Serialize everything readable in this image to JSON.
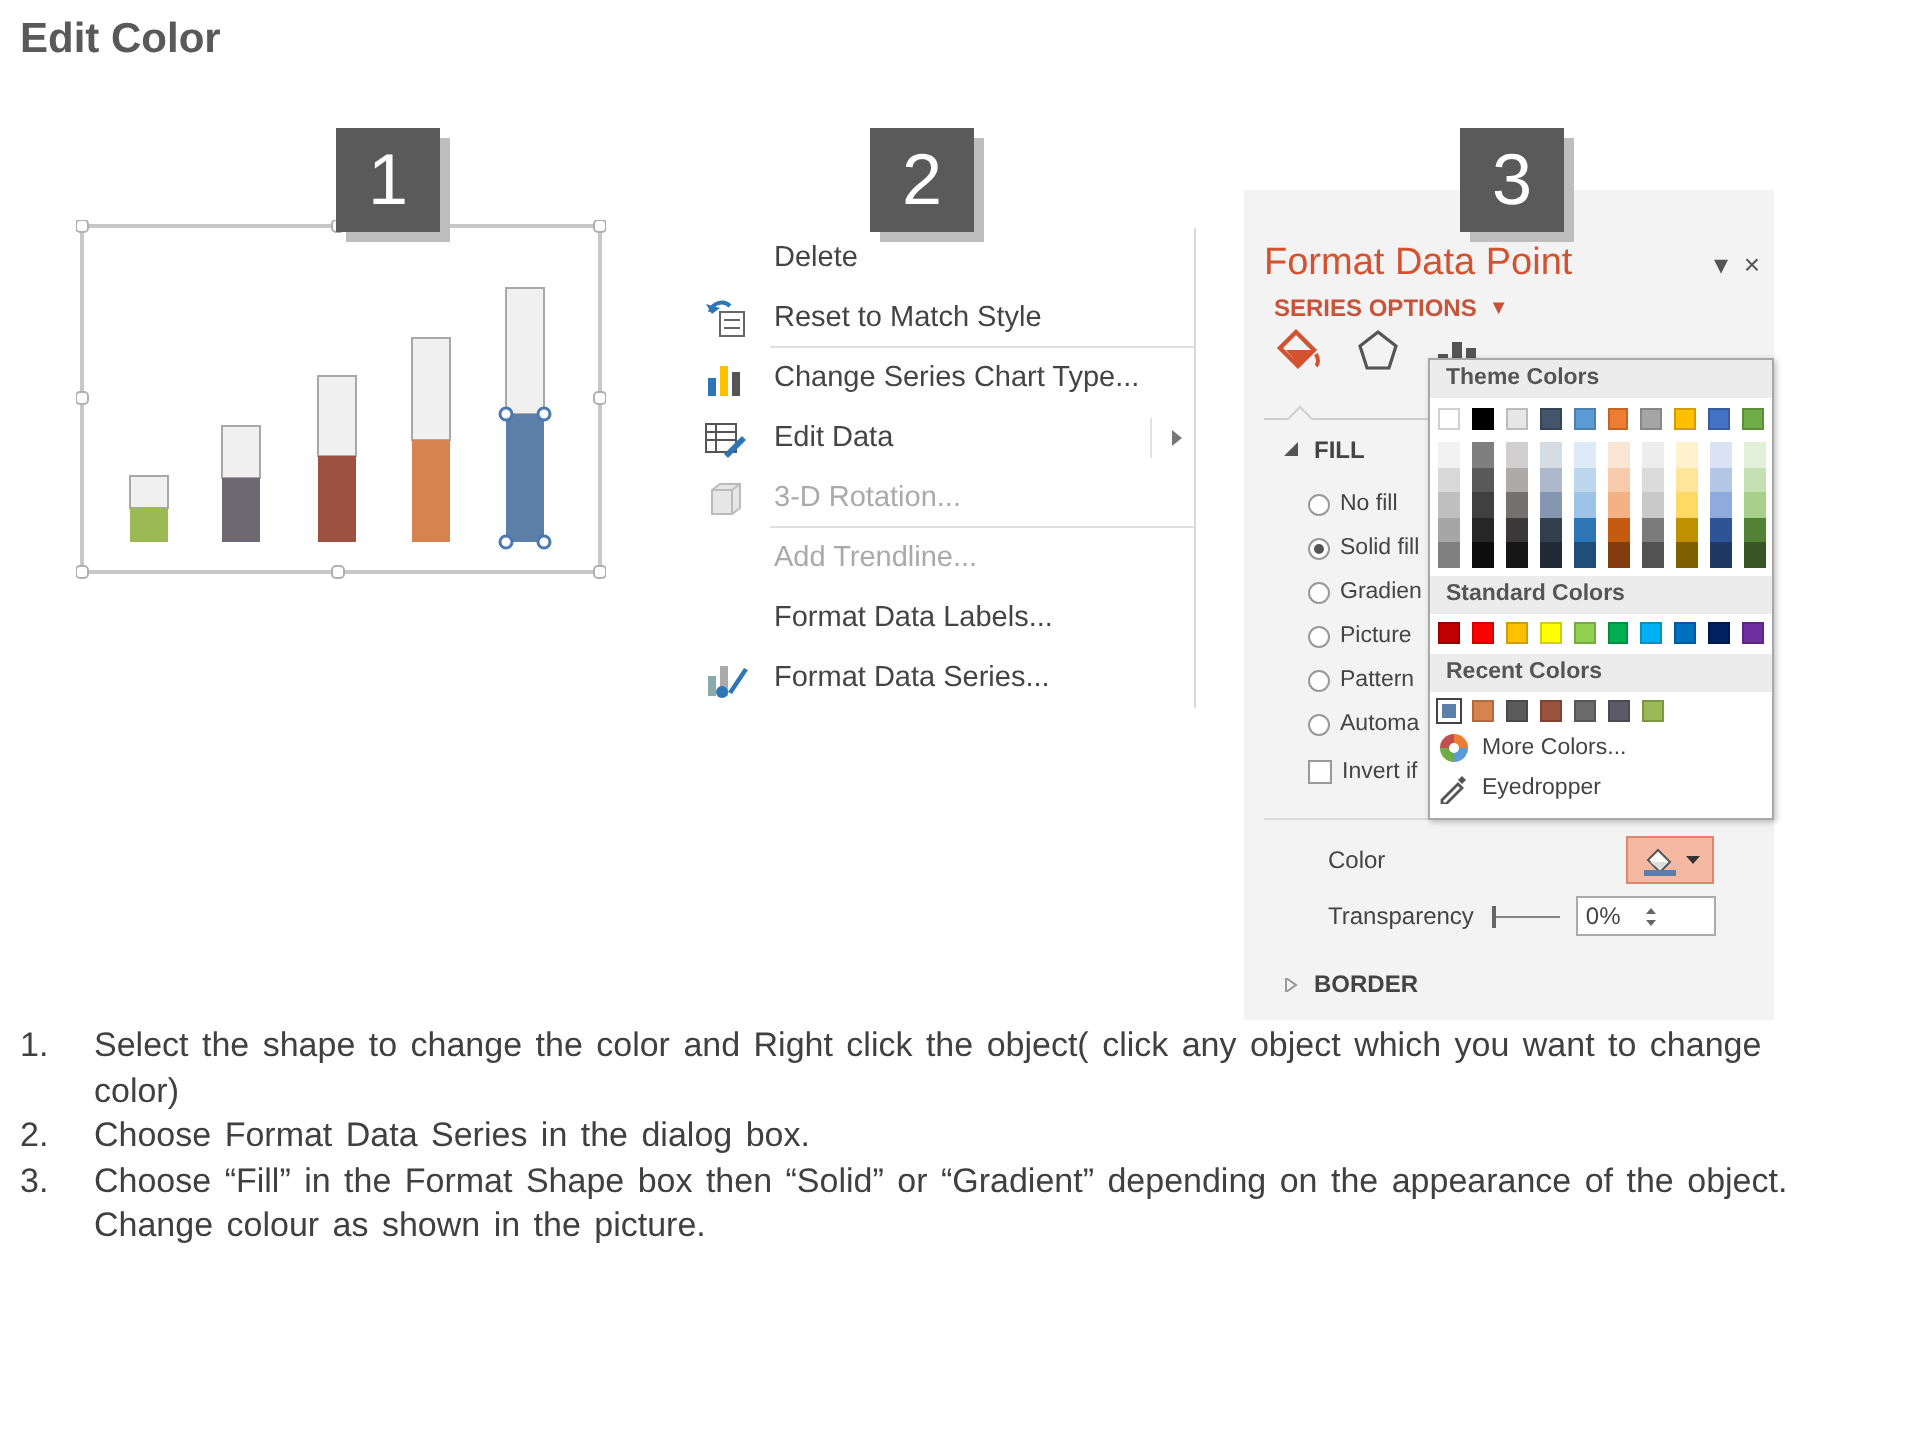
{
  "title": "Edit Color",
  "steps": [
    {
      "number": "1"
    },
    {
      "number": "2"
    },
    {
      "number": "3"
    }
  ],
  "chart_panel": {
    "bars": [
      {
        "color": "#9bb955",
        "selected": false
      },
      {
        "color": "#6e6870",
        "selected": false
      },
      {
        "color": "#9b5240",
        "selected": false
      },
      {
        "color": "#d7834f",
        "selected": false
      },
      {
        "color": "#5b7fa8",
        "selected": true
      }
    ]
  },
  "context_menu": {
    "items": [
      {
        "label": "Delete",
        "disabled": false,
        "separator_after": false,
        "has_submenu": false
      },
      {
        "label": "Reset to Match Style",
        "disabled": false,
        "separator_after": true,
        "has_submenu": false
      },
      {
        "label": "Change Series Chart Type...",
        "disabled": false,
        "separator_after": false,
        "has_submenu": false
      },
      {
        "label": "Edit Data",
        "disabled": false,
        "separator_after": false,
        "has_submenu": true
      },
      {
        "label": "3-D Rotation...",
        "disabled": true,
        "separator_after": true,
        "has_submenu": false
      },
      {
        "label": "Add Trendline...",
        "disabled": true,
        "separator_after": false,
        "has_submenu": false
      },
      {
        "label": "Format Data Labels...",
        "disabled": false,
        "separator_after": false,
        "has_submenu": false
      },
      {
        "label": "Format Data Series...",
        "disabled": false,
        "separator_after": false,
        "has_submenu": false
      }
    ]
  },
  "format_pane": {
    "title": "Format Data Point",
    "header_buttons": [
      "▾",
      "×"
    ],
    "section": "SERIES OPTIONS",
    "section_caret": "▼",
    "tabs": [
      {
        "selected": true
      },
      {
        "selected": false
      },
      {
        "selected": false
      }
    ],
    "fill": {
      "title": "FILL",
      "expanded": true,
      "options": [
        {
          "label": "No fill",
          "selected": false
        },
        {
          "label": "Solid fill",
          "selected": true
        },
        {
          "label": "Gradien",
          "selected": false
        },
        {
          "label": "Picture",
          "selected": false
        },
        {
          "label": "Pattern",
          "selected": false
        },
        {
          "label": "Automa",
          "selected": false
        }
      ],
      "invert": {
        "label": "Invert if",
        "checked": false
      },
      "color_label": "Color",
      "transparency": {
        "label": "Transparency",
        "value": "0%",
        "level": 0
      }
    },
    "border": {
      "title": "BORDER",
      "expanded": false
    }
  },
  "color_menu": {
    "theme_title": "Theme Colors",
    "theme": [
      {
        "color": "#ffffff",
        "shades": [
          {
            "color": "#f2f2f2"
          },
          {
            "color": "#d9d9d9"
          },
          {
            "color": "#bfbfbf"
          },
          {
            "color": "#a6a6a6"
          },
          {
            "color": "#808080"
          }
        ]
      },
      {
        "color": "#000000",
        "shades": [
          {
            "color": "#7f7f7f"
          },
          {
            "color": "#595959"
          },
          {
            "color": "#404040"
          },
          {
            "color": "#262626"
          },
          {
            "color": "#0d0d0d"
          }
        ]
      },
      {
        "color": "#e7e6e6",
        "shades": [
          {
            "color": "#d0cece"
          },
          {
            "color": "#aeaaaa"
          },
          {
            "color": "#757171"
          },
          {
            "color": "#3a3838"
          },
          {
            "color": "#171616"
          }
        ]
      },
      {
        "color": "#44546a",
        "shades": [
          {
            "color": "#d6dce4"
          },
          {
            "color": "#adb9ca"
          },
          {
            "color": "#8496b0"
          },
          {
            "color": "#333f4f"
          },
          {
            "color": "#222a35"
          }
        ]
      },
      {
        "color": "#5b9bd5",
        "shades": [
          {
            "color": "#deebf6"
          },
          {
            "color": "#bdd7ee"
          },
          {
            "color": "#9dc3e6"
          },
          {
            "color": "#2e75b5"
          },
          {
            "color": "#1f4e79"
          }
        ]
      },
      {
        "color": "#ed7d31",
        "shades": [
          {
            "color": "#fbe5d5"
          },
          {
            "color": "#f7cbac"
          },
          {
            "color": "#f4b183"
          },
          {
            "color": "#c55a11"
          },
          {
            "color": "#833c0b"
          }
        ]
      },
      {
        "color": "#a5a5a5",
        "shades": [
          {
            "color": "#ededed"
          },
          {
            "color": "#dbdbdb"
          },
          {
            "color": "#c9c9c9"
          },
          {
            "color": "#7b7b7b"
          },
          {
            "color": "#525252"
          }
        ]
      },
      {
        "color": "#ffc000",
        "shades": [
          {
            "color": "#fff2cc"
          },
          {
            "color": "#fee599"
          },
          {
            "color": "#ffd965"
          },
          {
            "color": "#bf9000"
          },
          {
            "color": "#7f6000"
          }
        ]
      },
      {
        "color": "#4472c4",
        "shades": [
          {
            "color": "#dae3f3"
          },
          {
            "color": "#b4c7e7"
          },
          {
            "color": "#8faadc"
          },
          {
            "color": "#2f5496"
          },
          {
            "color": "#1f3864"
          }
        ]
      },
      {
        "color": "#70ad47",
        "shades": [
          {
            "color": "#e2efd9"
          },
          {
            "color": "#c5e0b3"
          },
          {
            "color": "#a8d08d"
          },
          {
            "color": "#538135"
          },
          {
            "color": "#375623"
          }
        ]
      }
    ],
    "standard_title": "Standard Colors",
    "standard": [
      {
        "color": "#c00000"
      },
      {
        "color": "#ff0000"
      },
      {
        "color": "#ffc000"
      },
      {
        "color": "#ffff00"
      },
      {
        "color": "#92d050"
      },
      {
        "color": "#00b050"
      },
      {
        "color": "#00b0f0"
      },
      {
        "color": "#0070c0"
      },
      {
        "color": "#002060"
      },
      {
        "color": "#7030a0"
      }
    ],
    "recent_title": "Recent Colors",
    "recent": [
      {
        "color": "#5b7fa8",
        "selected": true
      },
      {
        "color": "#d7834f",
        "selected": false
      },
      {
        "color": "#5a5a5a",
        "selected": false
      },
      {
        "color": "#9b5240",
        "selected": false
      },
      {
        "color": "#6b6b6b",
        "selected": false
      },
      {
        "color": "#5c5a66",
        "selected": false
      },
      {
        "color": "#9bb955",
        "selected": false
      }
    ],
    "actions": [
      {
        "label": "More Colors..."
      },
      {
        "label": "Eyedropper"
      }
    ]
  },
  "instructions": [
    {
      "number": "1.",
      "text": "Select the shape to change the color and Right click the object( click any object which you want to change color)"
    },
    {
      "number": "2.",
      "text": "Choose Format Data Series in the dialog box."
    },
    {
      "number": "3.",
      "text": "Choose “Fill” in the Format Shape box then “Solid” or “Gradient” depending on the appearance of the object. Change colour as shown in the picture."
    }
  ]
}
